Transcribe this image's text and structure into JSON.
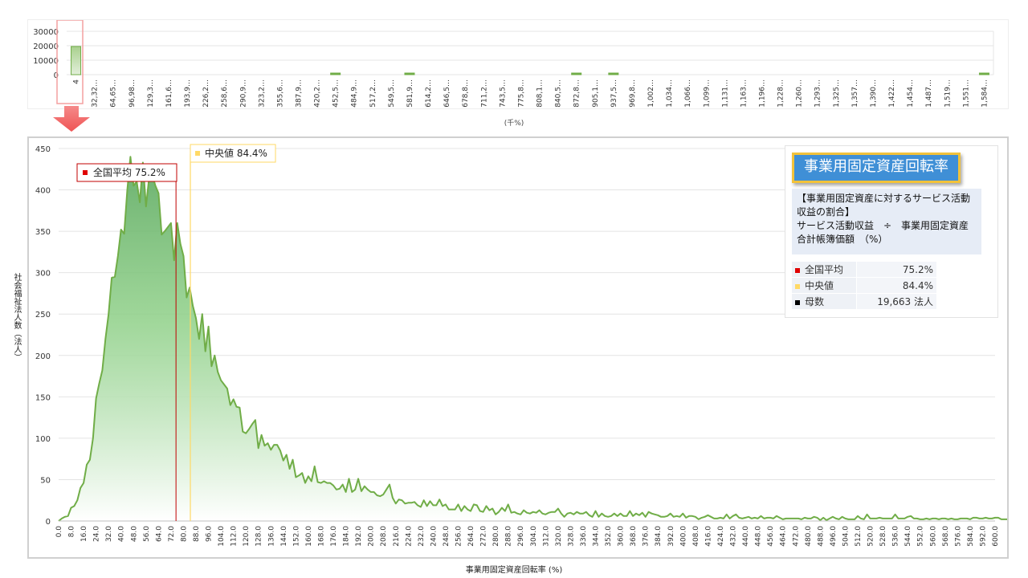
{
  "overview": {
    "y_ticks": [
      "30000",
      "20000",
      "10000",
      "0"
    ],
    "x_labels": [
      "4",
      "32,32…",
      "64,65…",
      "96,98…",
      "129,3…",
      "161,6…",
      "193,9…",
      "226,2…",
      "258,6…",
      "290,9…",
      "323,2…",
      "355,6…",
      "387,9…",
      "420,2…",
      "452,5…",
      "484,9…",
      "517,2…",
      "549,5…",
      "581,9…",
      "614,2…",
      "646,5…",
      "678,8…",
      "711,2…",
      "743,5…",
      "775,8…",
      "808,1…",
      "840,5…",
      "872,8…",
      "905,1…",
      "937,5…",
      "969,8…",
      "1,002…",
      "1,034…",
      "1,066…",
      "1,099…",
      "1,131…",
      "1,163…",
      "1,196…",
      "1,228…",
      "1,260…",
      "1,293…",
      "1,325…",
      "1,357…",
      "1,390…",
      "1,422…",
      "1,454…",
      "1,487…",
      "1,519…",
      "1,551…",
      "1,584…"
    ],
    "unit": "(千%)",
    "colors": {
      "bar": "#70ad47",
      "highlight": "#f4a0a0",
      "arrow": "#f06060"
    }
  },
  "main": {
    "ylabel": "社会福祉法人数（法人）",
    "xlabel": "事業用固定資産回転率 (%)",
    "avg_label": "全国平均",
    "avg_value": "75.2%",
    "median_label": "中央値",
    "median_value": "84.4%",
    "colors": {
      "series": "#70ad47",
      "avg": "#c00000",
      "median": "#ffd966"
    }
  },
  "info": {
    "title": "事業用固定資産回転率",
    "desc": [
      "【事業用固定資産に対するサービス活動",
      "収益の割合】",
      "サービス活動収益　÷　事業用固定資産",
      "合計帳簿価額　（%）"
    ],
    "rows": [
      {
        "label": "全国平均",
        "value": "75.2%",
        "color": "#e00000"
      },
      {
        "label": "中央値",
        "value": "84.4%",
        "color": "#ffd966"
      },
      {
        "label": "母数",
        "value": "19,663  法人",
        "color": "#000000"
      }
    ]
  },
  "chart_data": [
    {
      "type": "bar",
      "title": "",
      "xlabel": "(千%)",
      "ylabel": "",
      "ylim": [
        0,
        30000
      ],
      "categories": [
        "4",
        "32,32…",
        "64,65…",
        "96,98…",
        "129,3…",
        "161,6…",
        "193,9…",
        "226,2…",
        "258,6…",
        "290,9…",
        "323,2…",
        "355,6…",
        "387,9…",
        "420,2…",
        "452,5…",
        "484,9…",
        "517,2…",
        "549,5…",
        "581,9…",
        "614,2…",
        "646,5…",
        "678,8…",
        "711,2…",
        "743,5…",
        "775,8…",
        "808,1…",
        "840,5…",
        "872,8…",
        "905,1…",
        "937,5…",
        "969,8…",
        "1,002…",
        "1,034…",
        "1,066…",
        "1,099…",
        "1,131…",
        "1,163…",
        "1,196…",
        "1,228…",
        "1,260…",
        "1,293…",
        "1,325…",
        "1,357…",
        "1,390…",
        "1,422…",
        "1,454…",
        "1,487…",
        "1,519…",
        "1,551…",
        "1,584…"
      ],
      "values": [
        19500,
        0,
        0,
        0,
        0,
        0,
        0,
        0,
        0,
        0,
        0,
        0,
        0,
        0,
        600,
        0,
        0,
        0,
        600,
        0,
        0,
        0,
        0,
        0,
        0,
        0,
        0,
        400,
        0,
        600,
        0,
        0,
        0,
        0,
        0,
        0,
        0,
        0,
        0,
        0,
        0,
        0,
        0,
        0,
        0,
        0,
        0,
        0,
        0,
        600
      ],
      "grid": true
    },
    {
      "type": "area",
      "title": "",
      "xlabel": "事業用固定資産回転率 (%)",
      "ylabel": "社会福祉法人数（法人）",
      "xlim": [
        0,
        600
      ],
      "ylim": [
        0,
        450
      ],
      "x_step": 2,
      "yticks": [
        0,
        50,
        100,
        150,
        200,
        250,
        300,
        350,
        400,
        450
      ],
      "xticks": [
        "0.0",
        "8.0",
        "16.0",
        "24.0",
        "32.0",
        "40.0",
        "48.0",
        "56.0",
        "64.0",
        "72.0",
        "80.0",
        "88.0",
        "96.0",
        "104.0",
        "112.0",
        "120.0",
        "128.0",
        "136.0",
        "144.0",
        "152.0",
        "160.0",
        "168.0",
        "176.0",
        "184.0",
        "192.0",
        "200.0",
        "208.0",
        "216.0",
        "224.0",
        "232.0",
        "240.0",
        "248.0",
        "256.0",
        "264.0",
        "272.0",
        "280.0",
        "288.0",
        "296.0",
        "304.0",
        "312.0",
        "320.0",
        "328.0",
        "336.0",
        "344.0",
        "352.0",
        "360.0",
        "368.0",
        "376.0",
        "384.0",
        "392.0",
        "400.0",
        "408.0",
        "416.0",
        "424.0",
        "432.0",
        "440.0",
        "448.0",
        "456.0",
        "464.0",
        "472.0",
        "480.0",
        "488.0",
        "496.0",
        "504.0",
        "512.0",
        "520.0",
        "528.0",
        "536.0",
        "544.0",
        "552.0",
        "560.0",
        "568.0",
        "576.0",
        "584.0",
        "592.0",
        "600.0"
      ],
      "values": [
        0,
        3,
        5,
        6,
        16,
        18,
        25,
        40,
        46,
        68,
        74,
        100,
        148,
        166,
        182,
        220,
        250,
        294,
        295,
        320,
        352,
        347,
        400,
        440,
        405,
        410,
        385,
        433,
        380,
        415,
        418,
        405,
        396,
        346,
        350,
        355,
        360,
        315,
        360,
        335,
        320,
        270,
        282,
        260,
        245,
        220,
        250,
        205,
        235,
        187,
        200,
        180,
        170,
        165,
        160,
        140,
        147,
        138,
        137,
        108,
        106,
        111,
        117,
        122,
        88,
        104,
        91,
        94,
        86,
        92,
        92,
        85,
        73,
        80,
        63,
        74,
        53,
        55,
        58,
        46,
        54,
        48,
        66,
        47,
        46,
        48,
        46,
        46,
        43,
        38,
        39,
        44,
        35,
        51,
        35,
        38,
        51,
        36,
        42,
        38,
        35,
        35,
        31,
        30,
        32,
        38,
        44,
        28,
        21,
        26,
        25,
        21,
        22,
        22,
        23,
        19,
        17,
        25,
        18,
        24,
        19,
        19,
        26,
        18,
        20,
        14,
        14,
        14,
        20,
        12,
        18,
        14,
        12,
        20,
        19,
        12,
        11,
        18,
        13,
        15,
        8,
        11,
        16,
        12,
        20,
        10,
        11,
        9,
        8,
        13,
        10,
        9,
        11,
        10,
        13,
        9,
        8,
        10,
        11,
        11,
        15,
        9,
        5,
        9,
        10,
        8,
        11,
        9,
        9,
        11,
        7,
        5,
        12,
        5,
        9,
        6,
        5,
        6,
        9,
        6,
        9,
        6,
        6,
        12,
        6,
        9,
        7,
        10,
        5,
        11,
        9,
        8,
        7,
        5,
        5,
        6,
        9,
        5,
        6,
        5,
        9,
        4,
        6,
        6,
        5,
        2,
        4,
        5,
        7,
        5,
        3,
        3,
        4,
        3,
        8,
        3,
        6,
        8,
        4,
        3,
        4,
        5,
        3,
        4,
        3,
        6,
        3,
        4,
        4,
        3,
        6,
        4,
        2,
        3,
        3,
        3,
        3,
        3,
        2,
        4,
        3,
        3,
        5,
        4,
        1,
        4,
        1,
        3,
        5,
        3,
        2,
        5,
        3,
        2,
        2,
        2,
        6,
        3,
        2,
        8,
        3,
        3,
        3,
        4,
        3,
        3,
        3,
        3,
        8,
        3,
        3,
        3,
        5,
        6,
        3,
        3,
        2,
        2,
        3,
        2,
        3,
        3,
        2,
        3,
        3,
        2,
        3,
        2,
        2,
        3,
        3,
        3,
        2,
        4,
        4,
        3,
        3,
        4,
        3,
        3,
        4,
        4,
        2,
        2,
        2,
        3,
        3,
        3,
        3,
        3,
        3
      ],
      "series": [
        {
          "name": "",
          "color": "#70ad47"
        }
      ],
      "grid": true
    }
  ]
}
